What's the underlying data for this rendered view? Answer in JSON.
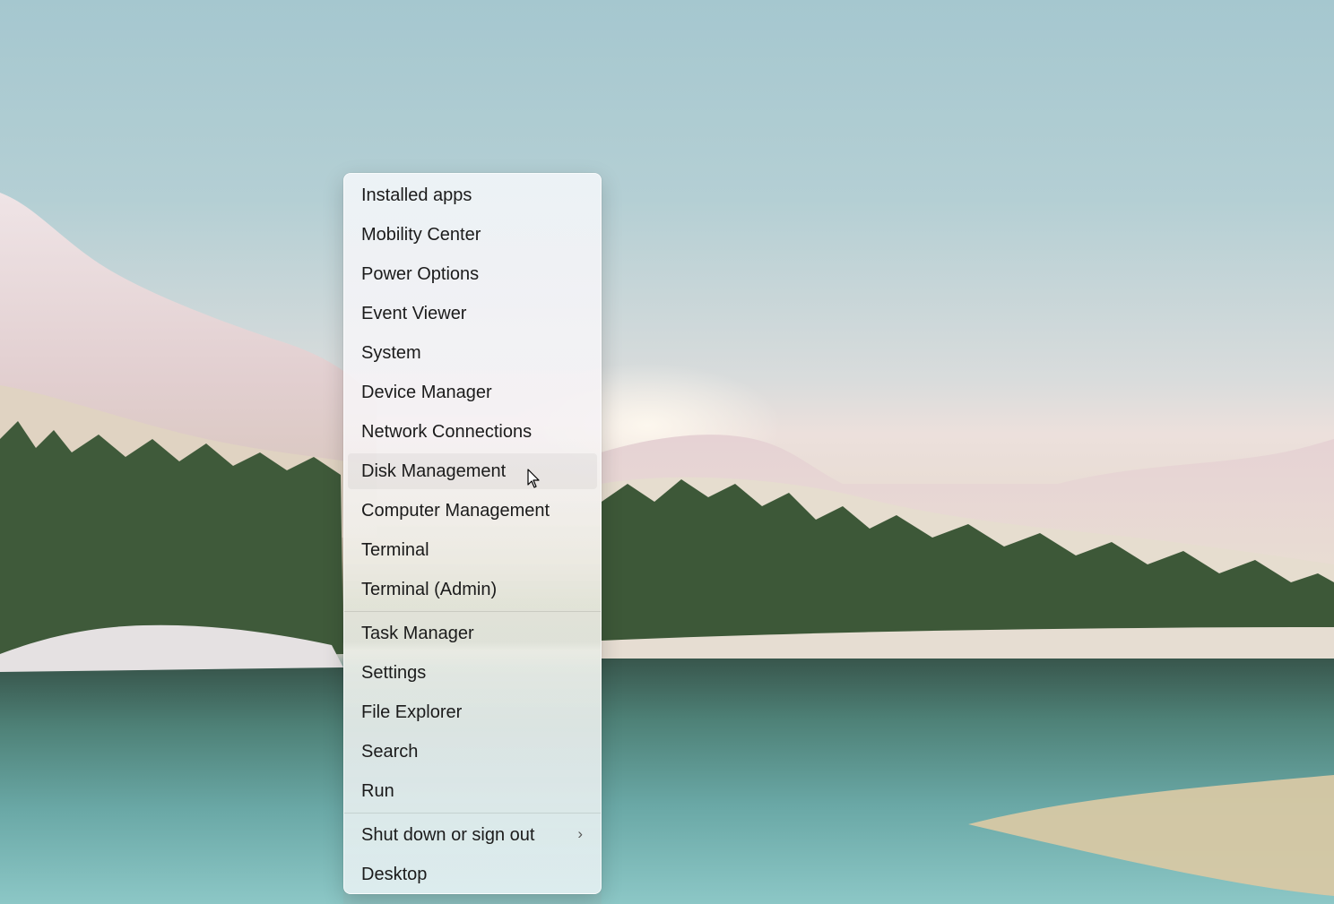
{
  "menu": {
    "groups": [
      [
        "Installed apps",
        "Mobility Center",
        "Power Options",
        "Event Viewer",
        "System",
        "Device Manager",
        "Network Connections",
        "Disk Management",
        "Computer Management",
        "Terminal",
        "Terminal (Admin)"
      ],
      [
        "Task Manager",
        "Settings",
        "File Explorer",
        "Search",
        "Run"
      ],
      [
        "Shut down or sign out",
        "Desktop"
      ]
    ],
    "hovered_item": "Disk Management",
    "submenu_item": "Shut down or sign out"
  },
  "icons": {
    "submenu_indicator": "chevron-right-icon",
    "pointer": "mouse-cursor-icon"
  },
  "colors": {
    "menu_text": "#1b1b1b",
    "hover_background": "rgba(0,0,0,0.045)"
  }
}
